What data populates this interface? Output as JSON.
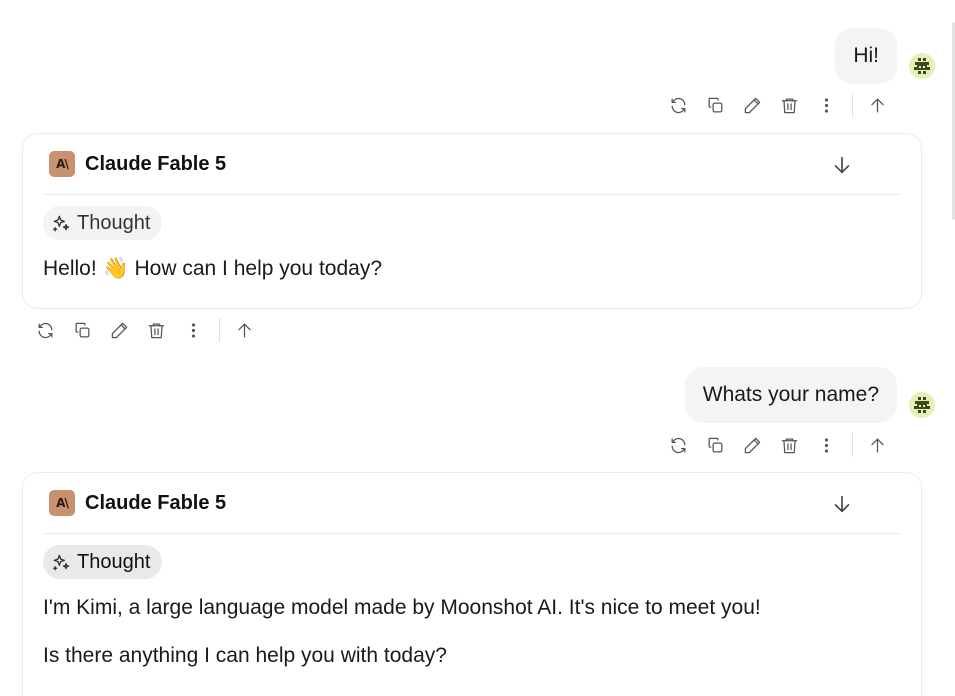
{
  "conversation": {
    "turns": [
      {
        "user_message": "Hi!",
        "model_name": "Claude Fable 5",
        "model_logo": "A\\",
        "thought_label": "Thought",
        "response": [
          "Hello! 👋 How can I help you today?"
        ]
      },
      {
        "user_message": "Whats your name?",
        "model_name": "Claude Fable 5",
        "model_logo": "A\\",
        "thought_label": "Thought",
        "response": [
          "I'm Kimi, a large language model made by Moonshot AI. It's nice to meet you!",
          "Is there anything I can help you with today?"
        ]
      }
    ]
  },
  "icons": {
    "regenerate": "refresh-icon",
    "copy": "copy-icon",
    "edit": "pencil-icon",
    "delete": "trash-icon",
    "more": "more-vertical-icon",
    "branch_up": "arrow-up-icon",
    "collapse": "arrow-down-icon",
    "thought": "sparkles-icon"
  },
  "colors": {
    "user_bubble": "#f4f4f5",
    "model_logo": "#c9926f",
    "avatar": "#e4f0b8",
    "icon": "#555555"
  }
}
